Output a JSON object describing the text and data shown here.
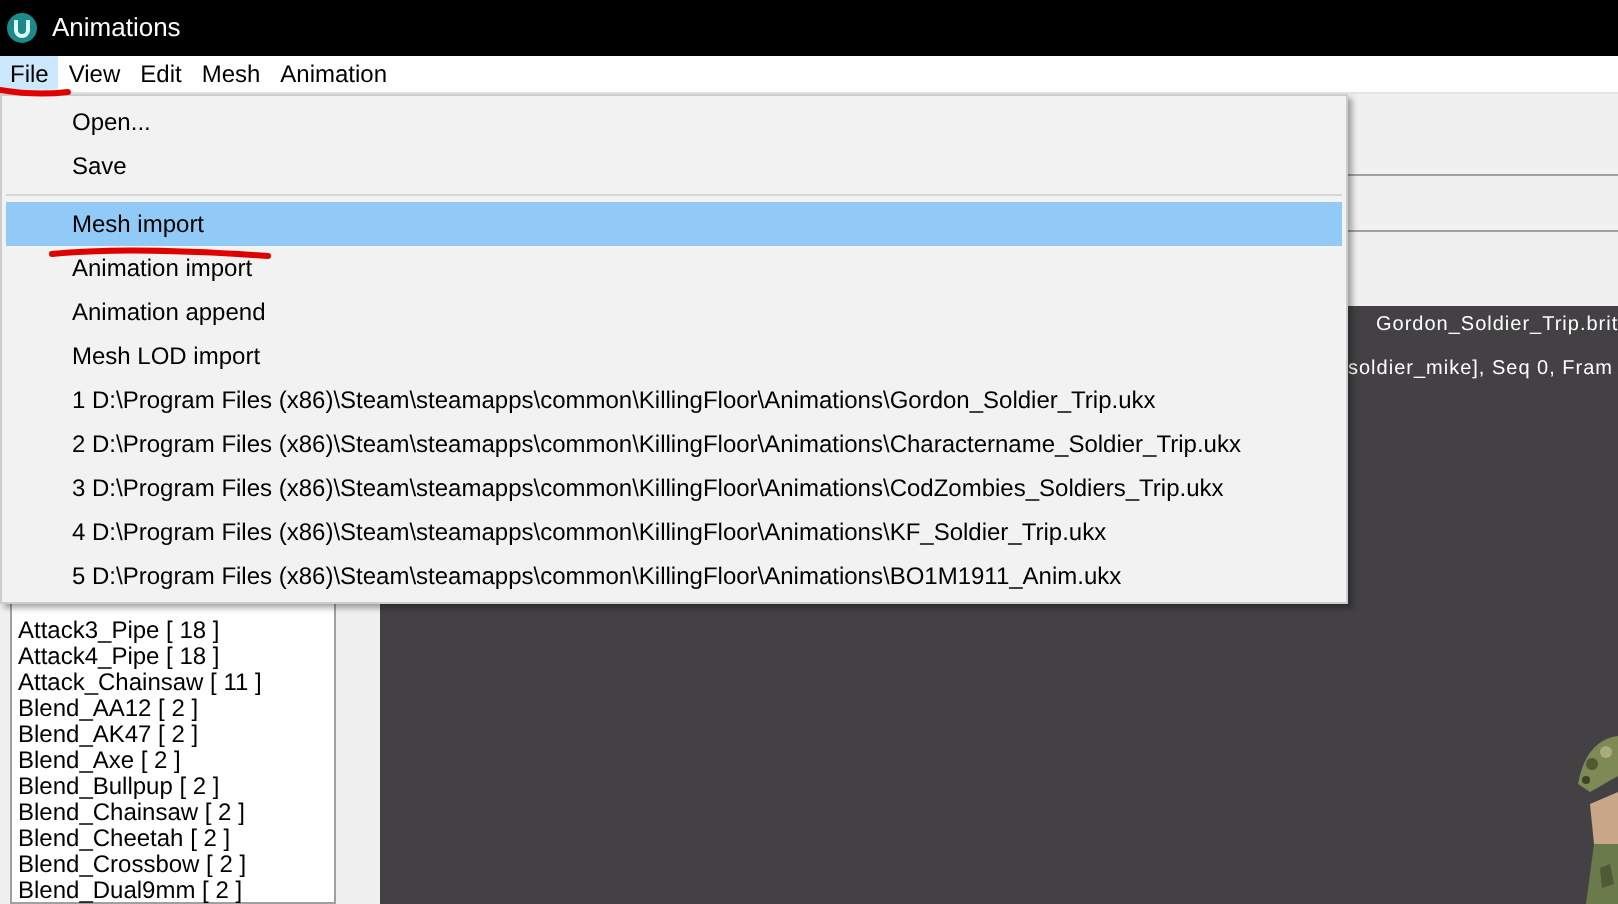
{
  "window": {
    "title": "Animations"
  },
  "menubar": [
    {
      "label": "File",
      "selected": true
    },
    {
      "label": "View",
      "selected": false
    },
    {
      "label": "Edit",
      "selected": false
    },
    {
      "label": "Mesh",
      "selected": false
    },
    {
      "label": "Animation",
      "selected": false
    }
  ],
  "file_menu": [
    {
      "kind": "item",
      "label": "Open...",
      "selected": false
    },
    {
      "kind": "item",
      "label": "Save",
      "selected": false
    },
    {
      "kind": "separator"
    },
    {
      "kind": "item",
      "label": "Mesh import",
      "selected": true
    },
    {
      "kind": "item",
      "label": "Animation import",
      "selected": false
    },
    {
      "kind": "item",
      "label": "Animation append",
      "selected": false
    },
    {
      "kind": "item",
      "label": "Mesh LOD import",
      "selected": false
    },
    {
      "kind": "item",
      "label": "1 D:\\Program Files (x86)\\Steam\\steamapps\\common\\KillingFloor\\Animations\\Gordon_Soldier_Trip.ukx",
      "selected": false
    },
    {
      "kind": "item",
      "label": "2 D:\\Program Files (x86)\\Steam\\steamapps\\common\\KillingFloor\\Animations\\Charactername_Soldier_Trip.ukx",
      "selected": false
    },
    {
      "kind": "item",
      "label": "3 D:\\Program Files (x86)\\Steam\\steamapps\\common\\KillingFloor\\Animations\\CodZombies_Soldiers_Trip.ukx",
      "selected": false
    },
    {
      "kind": "item",
      "label": "4 D:\\Program Files (x86)\\Steam\\steamapps\\common\\KillingFloor\\Animations\\KF_Soldier_Trip.ukx",
      "selected": false
    },
    {
      "kind": "item",
      "label": "5 D:\\Program Files (x86)\\Steam\\steamapps\\common\\KillingFloor\\Animations\\BO1M1911_Anim.ukx",
      "selected": false
    }
  ],
  "viewport": {
    "header": "Gordon_Soldier_Trip.brit",
    "info": "soldier_mike], Seq 0,  Fram"
  },
  "sequence_list": [
    "Attack3_Pipe [ 18 ]",
    "Attack4_Pipe [ 18 ]",
    "Attack_Chainsaw [ 11 ]",
    "Blend_AA12 [ 2 ]",
    "Blend_AK47 [ 2 ]",
    "Blend_Axe [ 2 ]",
    "Blend_Bullpup [ 2 ]",
    "Blend_Chainsaw [ 2 ]",
    "Blend_Cheetah [ 2 ]",
    "Blend_Crossbow [ 2 ]",
    "Blend_Dual9mm [ 2 ]"
  ]
}
